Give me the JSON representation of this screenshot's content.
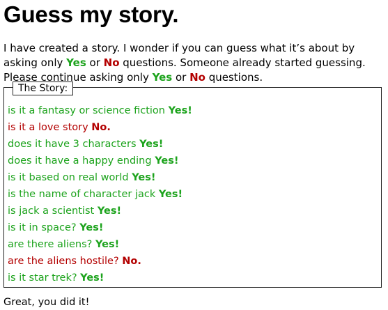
{
  "title": "Guess my story.",
  "intro": {
    "part1": "I have created a story. I wonder if you can guess what it’s about by asking only ",
    "yes1": "Yes",
    "or1": " or ",
    "no1": "No",
    "part2": " questions. Someone already started guessing. Please continue asking only ",
    "yes2": "Yes",
    "or2": " or ",
    "no2": "No",
    "part3": " questions."
  },
  "story_legend": "The Story:",
  "questions": [
    {
      "text": "is it a fantasy or science fiction",
      "answer": "Yes!",
      "kind": "yes"
    },
    {
      "text": "is it a love story",
      "answer": "No.",
      "kind": "no"
    },
    {
      "text": "does it have 3 characters",
      "answer": "Yes!",
      "kind": "yes"
    },
    {
      "text": "does it have a happy ending",
      "answer": "Yes!",
      "kind": "yes"
    },
    {
      "text": "is it based on real world",
      "answer": "Yes!",
      "kind": "yes"
    },
    {
      "text": "is the name of character jack",
      "answer": "Yes!",
      "kind": "yes"
    },
    {
      "text": "is jack a scientist",
      "answer": "Yes!",
      "kind": "yes"
    },
    {
      "text": "is it in space?",
      "answer": "Yes!",
      "kind": "yes"
    },
    {
      "text": "are there aliens?",
      "answer": "Yes!",
      "kind": "yes"
    },
    {
      "text": "are the aliens hostile?",
      "answer": "No.",
      "kind": "no"
    },
    {
      "text": "is it star trek?",
      "answer": "Yes!",
      "kind": "yes"
    }
  ],
  "final_message": "Great, you did it!",
  "colors": {
    "yes": "#1ca31c",
    "no": "#b30000"
  }
}
